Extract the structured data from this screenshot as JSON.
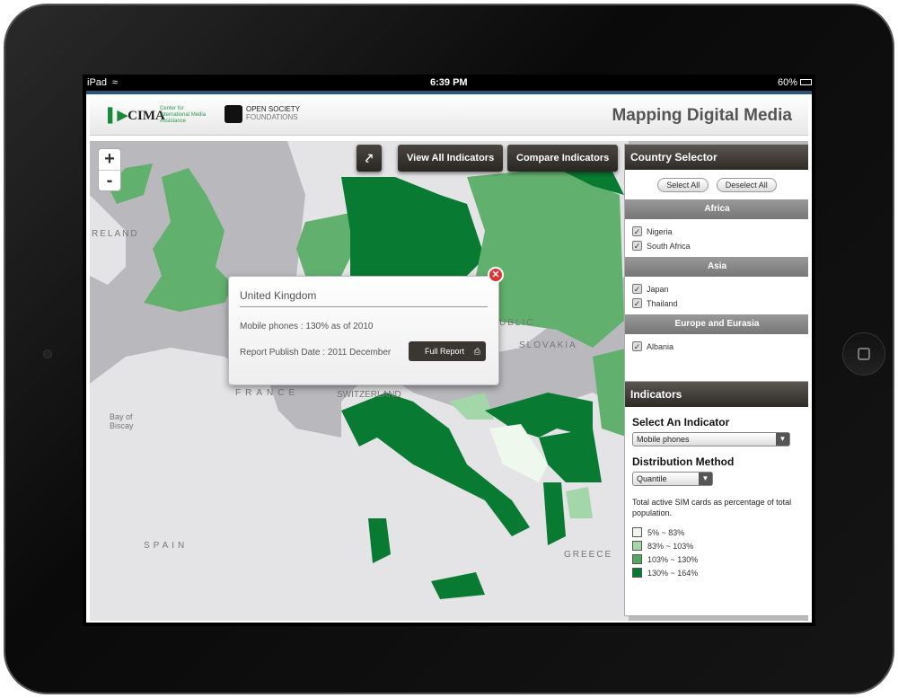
{
  "status": {
    "device": "iPad",
    "time": "6:39 PM",
    "battery": "60%"
  },
  "header": {
    "cima": "CIMA",
    "cima_sub": "Center for International Media Assistance",
    "osf_line1": "OPEN SOCIETY",
    "osf_line2": "FOUNDATIONS",
    "title": "Mapping Digital Media"
  },
  "map": {
    "labels": [
      "RELAND",
      "FRANCE",
      "SWITZERLAND",
      "SPAIN",
      "SLOVAKIA",
      "GREECE",
      "Bay of Biscay",
      "UBLIC"
    ],
    "zoom_in": "+",
    "zoom_out": "-"
  },
  "toolbar": {
    "share_icon": "share-icon",
    "view_all": "View All Indicators",
    "compare": "Compare Indicators"
  },
  "popup": {
    "country": "United Kingdom",
    "indicator": "Mobile phones : 130% as of 2010",
    "publish": "Report Publish Date : 2011 December",
    "full_report": "Full Report"
  },
  "country_selector": {
    "title": "Country Selector",
    "select_all": "Select All",
    "deselect_all": "Deselect All",
    "regions": [
      {
        "name": "Africa",
        "countries": [
          "Nigeria",
          "South Africa"
        ]
      },
      {
        "name": "Asia",
        "countries": [
          "Japan",
          "Thailand"
        ]
      },
      {
        "name": "Europe and Eurasia",
        "countries": [
          "Albania"
        ]
      }
    ]
  },
  "indicators": {
    "title": "Indicators",
    "select_label": "Select An Indicator",
    "selected": "Mobile phones",
    "dist_label": "Distribution Method",
    "dist_selected": "Quantile",
    "description": "Total active SIM cards as percentage of total population.",
    "legend": [
      {
        "label": "5% ~ 83%",
        "color": "#eef8ec"
      },
      {
        "label": "83% ~ 103%",
        "color": "#a3d6a8"
      },
      {
        "label": "103% ~ 130%",
        "color": "#52a862"
      },
      {
        "label": "130% ~ 164%",
        "color": "#087a32"
      }
    ]
  }
}
